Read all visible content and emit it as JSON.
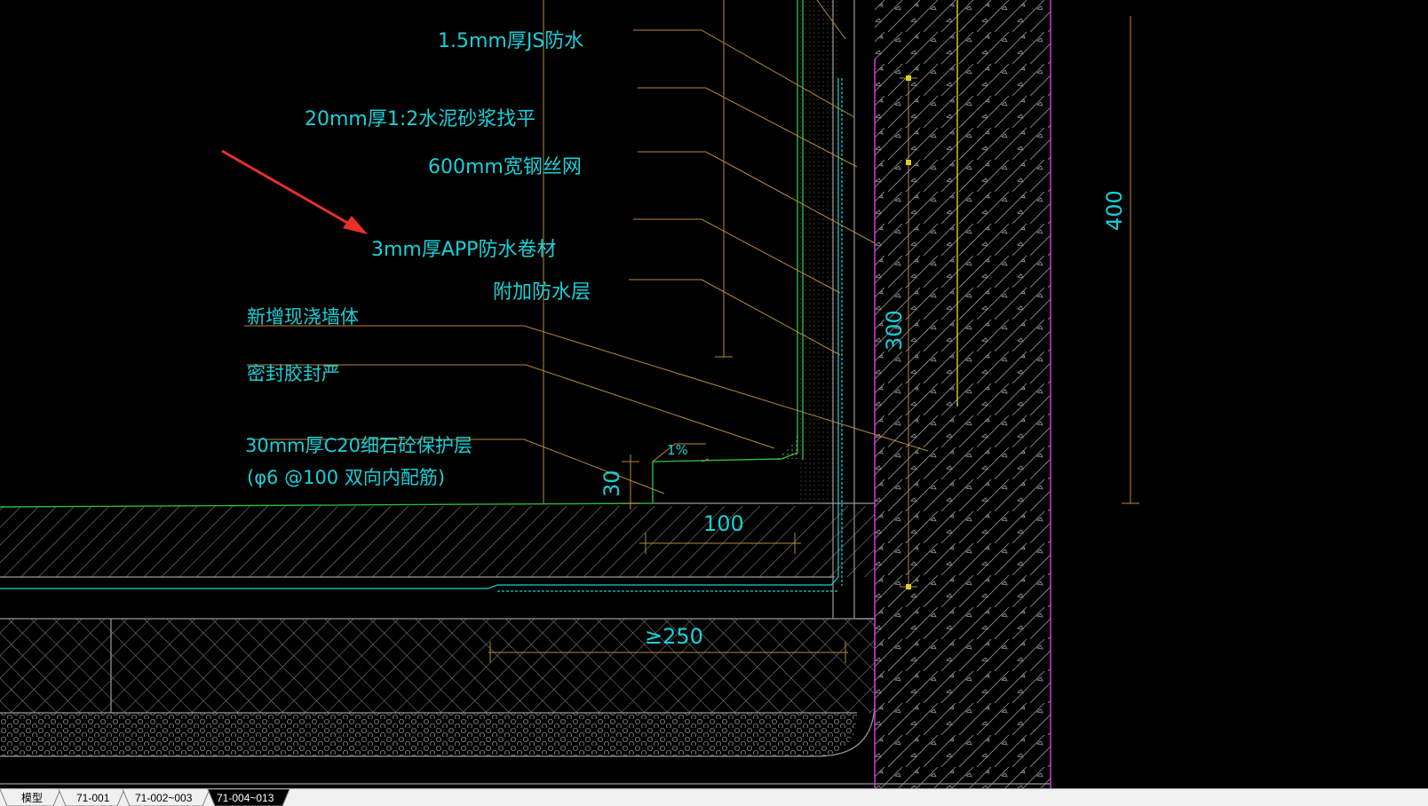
{
  "drawing": {
    "labels": {
      "js_waterproof": "1.5mm厚JS防水",
      "mortar": "20mm厚1:2水泥砂浆找平",
      "wire_mesh": "600mm宽钢丝网",
      "app_membrane": "3mm厚APP防水卷材",
      "extra_layer": "附加防水层",
      "new_wall": "新增现浇墙体",
      "sealant": "密封胶封严",
      "protect_1": "30mm厚C20细石砼保护层",
      "protect_2": "(φ6 @100 双向内配筋)"
    },
    "dims": {
      "d400": "400",
      "d300": "300",
      "d30": "30",
      "d100": "100",
      "d250": "≥250",
      "slope": "1%"
    }
  },
  "tabs": [
    {
      "label": "模型"
    },
    {
      "label": "71-001"
    },
    {
      "label": "71-002~003"
    },
    {
      "label": "71-004~013"
    }
  ],
  "colors": {
    "cyan": "#18d0d8",
    "leader": "#b8893a",
    "green": "#2fb83a",
    "magenta": "#d23adc",
    "yellow": "#d8d028",
    "arrow": "#e8302a"
  }
}
